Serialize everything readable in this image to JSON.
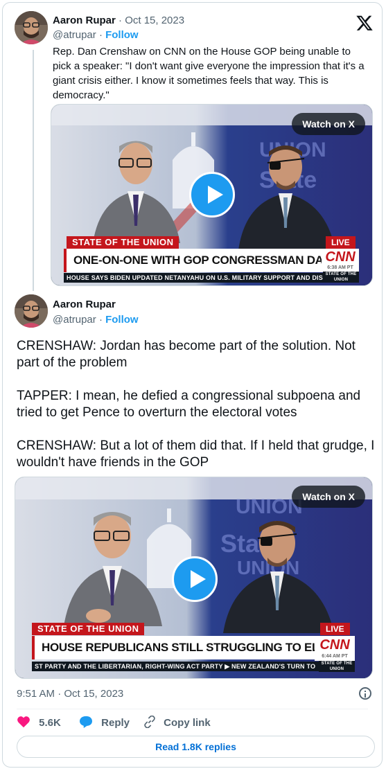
{
  "quoted_tweet": {
    "author_name": "Aaron Rupar",
    "separator": "·",
    "date": "Oct 15, 2023",
    "handle": "@atrupar",
    "follow_label": "Follow",
    "text": "Rep. Dan Crenshaw on CNN on the House GOP being unable to pick a speaker: \"I don't want give everyone the impression that it's a giant crisis either. I know it sometimes feels that way. This is democracy.\"",
    "video": {
      "watch_label": "Watch on X",
      "program": "STATE OF THE UNION",
      "live": "LIVE",
      "headline": "ONE-ON-ONE WITH GOP CONGRESSMAN DAN CRENSHAW",
      "network": "CNN",
      "time": "6:38 AM PT",
      "ticker": "HOUSE SAYS BIDEN UPDATED NETANYAHU ON U.S. MILITARY SUPPORT AND DISCUSSED",
      "bug": "STATE OF THE UNION"
    }
  },
  "tweet": {
    "author_name": "Aaron Rupar",
    "handle": "@atrupar",
    "separator": "·",
    "follow_label": "Follow",
    "paragraphs": [
      "CRENSHAW: Jordan has become part of the solution. Not part of the problem",
      "TAPPER: I mean, he defied a congressional subpoena and tried to get Pence to overturn the electoral votes",
      "CRENSHAW: But a lot of them did that. If I held that grudge, I wouldn't have friends in the GOP"
    ],
    "video": {
      "watch_label": "Watch on X",
      "program": "STATE OF THE UNION",
      "live": "LIVE",
      "headline": "HOUSE REPUBLICANS STILL STRUGGLING TO ELECT A SPEAKER",
      "network": "CNN",
      "time": "6:44 AM PT",
      "ticker": "ST PARTY AND THE LIBERTARIAN, RIGHT-WING ACT PARTY  ▶  NEW ZEALAND'S TURN TO",
      "bug": "STATE OF THE UNION"
    },
    "timestamp": "9:51 AM · Oct 15, 2023",
    "likes": "5.6K",
    "reply_label": "Reply",
    "copy_label": "Copy link",
    "read_replies": "Read 1.8K replies"
  },
  "colors": {
    "accent": "#1d9bf0",
    "like": "#f91880",
    "cnn_red": "#c4161c"
  },
  "icons": [
    "x-logo-icon",
    "play-icon",
    "heart-icon",
    "reply-bubble-icon",
    "link-icon",
    "info-icon"
  ]
}
